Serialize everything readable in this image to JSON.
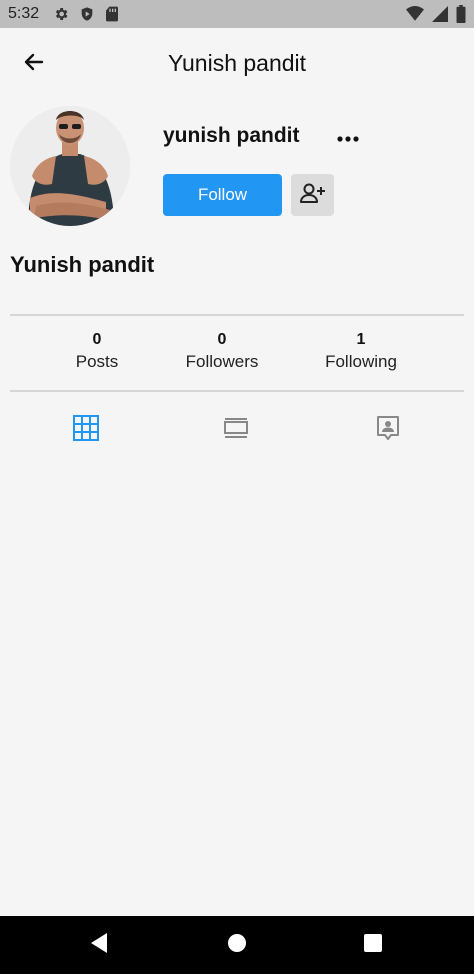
{
  "status_bar": {
    "time": "5:32",
    "left_icons": [
      "gear-icon",
      "shield-icon",
      "sd-card-icon"
    ],
    "right_icons": [
      "wifi-icon",
      "signal-icon",
      "battery-icon"
    ]
  },
  "app_bar": {
    "title": "Yunish pandit",
    "back_icon": "arrow-back-icon"
  },
  "profile": {
    "username": "yunish pandit",
    "display_name": "Yunish pandit",
    "follow_label": "Follow",
    "more_icon": "more-horizontal-icon",
    "add_user_icon": "person-add-icon"
  },
  "stats": [
    {
      "count": "0",
      "label": "Posts"
    },
    {
      "count": "0",
      "label": "Followers"
    },
    {
      "count": "1",
      "label": "Following"
    }
  ],
  "tabs": [
    {
      "icon": "grid-icon",
      "active": true
    },
    {
      "icon": "feed-list-icon",
      "active": false
    },
    {
      "icon": "tagged-person-icon",
      "active": false
    }
  ],
  "nav_bar": [
    "back-triangle-icon",
    "home-circle-icon",
    "recents-square-icon"
  ],
  "colors": {
    "accent": "#2196f3",
    "background": "#f5f5f5",
    "status_bar": "#bdbdbd",
    "nav_bar": "#000000"
  }
}
